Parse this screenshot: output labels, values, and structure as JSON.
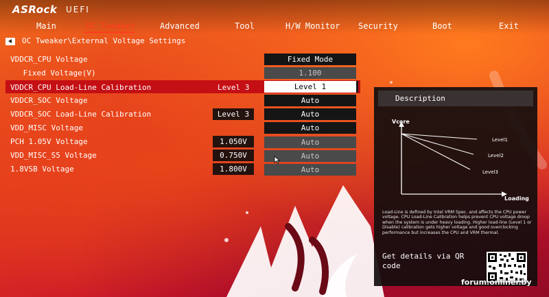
{
  "brand": {
    "logo": "ASRock",
    "sub": "UEFI"
  },
  "nav": {
    "items": [
      "Main",
      "OC Tweaker",
      "Advanced",
      "Tool",
      "H/W Monitor",
      "Security",
      "Boot",
      "Exit"
    ],
    "active": "OC Tweaker"
  },
  "breadcrumb": {
    "back_icon": "back-arrow-icon",
    "path": "OC Tweaker\\External Voltage Settings"
  },
  "rows": [
    {
      "label": "VDDCR_CPU Voltage",
      "value": "",
      "option": "Fixed Mode",
      "state": "normal"
    },
    {
      "label": " Fixed Voltage(V)",
      "value": "",
      "option": "1.100",
      "state": "dim"
    },
    {
      "label": "VDDCR_CPU Load-Line Calibration",
      "value": "Level 3",
      "option": "Level 1",
      "state": "selected"
    },
    {
      "label": "VDDCR_SOC Voltage",
      "value": "",
      "option": "Auto",
      "state": "normal"
    },
    {
      "label": "VDDCR_SOC Load-Line Calibration",
      "value": "Level 3",
      "option": "Auto",
      "state": "normal"
    },
    {
      "label": "VDD_MISC Voltage",
      "value": "",
      "option": "Auto",
      "state": "normal"
    },
    {
      "label": "PCH 1.05V Voltage",
      "value": "1.050V",
      "option": "Auto",
      "state": "dim"
    },
    {
      "label": "VDD_MISC_S5 Voltage",
      "value": "0.750V",
      "option": "Auto",
      "state": "dim"
    },
    {
      "label": "1.8VSB Voltage",
      "value": "1.800V",
      "option": "Auto",
      "state": "dim"
    }
  ],
  "description": {
    "title": "Description",
    "chart": {
      "ylabel": "Vcore",
      "xlabel": "Loading",
      "lines": [
        "Level1",
        "Level2",
        "Level3"
      ]
    },
    "text": "Load-Line is defined by Intel VRM Spec. and affects the CPU power voltage. CPU Load-Line Calibration helps prevent CPU voltage droop when the system is under heavy loading. Higher load-line (Level 1 or Disable) calibration gets higher voltage and good overclocking performance but increases the CPU and VRM thermal.",
    "qr_text": "Get details via QR code"
  },
  "watermark": "forum.onliner.by",
  "colors": {
    "accent": "#ff3b1f",
    "highlight": "#c40f14",
    "panel": "#161010"
  }
}
